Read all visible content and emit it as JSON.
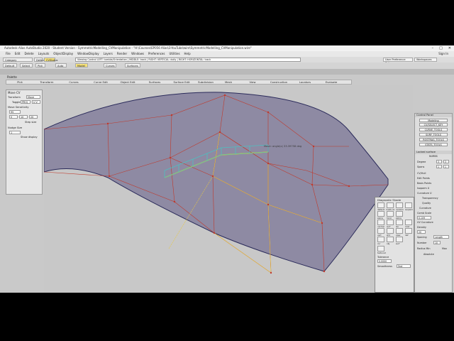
{
  "window": {
    "title": "Autodesk Alias AutoStudio 2020  -  Student Version  -  SymmetricModelling_CVManipulation - \"H:\\Courses\\EP056 Alias\\3-YouTube\\wire\\SymmetricModelling_CVManipulation.wire\"",
    "min": "–",
    "max": "□",
    "close": "✕"
  },
  "menu": {
    "items": [
      "File",
      "Edit",
      "Delete",
      "Layouts",
      "ObjectDisplay",
      "WindowDisplay",
      "Layers",
      "Render",
      "Windows",
      "Preferences",
      "Utilities",
      "Help"
    ],
    "signin": "Sign In"
  },
  "toolbar": {
    "category_label": "Category",
    "status_text": "Viewing Control    LEFT: tumble/Orientation  |  MIDDLE: track  |  RIGHT: VERTICAL: dolly  |  RIGHT: HORIZONTAL: track",
    "user_prefs": "User Preference Sets",
    "workspaces": "Workspaces",
    "default_label": "Default",
    "cv_status": "CVStatus",
    "row2_items": [
      "Default",
      "Select",
      "Pick",
      "Auto",
      "Model",
      "Curves",
      "Surfaces"
    ]
  },
  "palette": {
    "label": "Palette",
    "shelf_tabs": [
      "Pick",
      "Transform",
      "Curves",
      "Curve Edit",
      "Object Edit",
      "Surfaces",
      "Surface Edit",
      "Subdivision",
      "Mesh",
      "View",
      "Construction",
      "Locators",
      "Evaluate"
    ]
  },
  "move_cv_panel": {
    "title": "Move CV",
    "transform_label": "Transform",
    "transform_value": "Move",
    "toggle_label": "Toggle",
    "toggle_value": "PROJ",
    "toggle_value2": "U V",
    "move_sensitivity": "Move Sensitivity",
    "sensitivity_value": "95",
    "fields": [
      "0",
      "10",
      "20"
    ],
    "step_size_label": "Step size",
    "step_size_value": "",
    "nudge_size": "Nudge Size",
    "nudge_value": "1",
    "show_display": "Show display"
  },
  "viewport": {
    "annotation": "Move: angle(x) 33.39758 deg",
    "viewcube_label": "RIGHT",
    "axis_labels": {
      "y": "Y",
      "z": "Z"
    }
  },
  "control_panel": {
    "title": "Control Panel",
    "modeling": "Modeling",
    "cv_select": "CV/SELECT_KEY",
    "buttons": [
      "CURVE_TOOLS",
      "SURF_TOOLS",
      "ROSTRAG_TOOLS",
      "STATS_TOOLS"
    ],
    "locked_surface": "Locked surface",
    "nurbs_label": "NURBS",
    "degree_label": "Degree",
    "degree_u": "3",
    "degree_v": "3",
    "spans_label": "Spans",
    "spans_u": "1",
    "spans_v": "1",
    "cvs_hull": "CV/Hull",
    "edit_points": "Edit Points",
    "basis_points": "Basis Points",
    "isoparm_u": "Isoparm U",
    "curvature_u": "Curvature U",
    "transparency": "Transparency",
    "quality": "Quality",
    "curvature": "Curvature",
    "comb_scale": "Comb Scale",
    "comb_value": "0.109",
    "uv_curvature": "UV Curvature",
    "density": "Density",
    "density_value": "20",
    "spacing": "Spacing",
    "spacing_value": "Length",
    "number": "Number",
    "number_value": "10",
    "radius_min": "Radius Min",
    "radius_max": "Max",
    "absolute": "Absolute"
  },
  "diagnostic_shade": {
    "title": "Diagnostic Shade",
    "icons": [
      "default",
      "mulit-col",
      "random",
      "isoparm",
      "zebra",
      "horiz",
      "zebra",
      "normal",
      "surf",
      "Iso",
      "mod",
      "vert",
      "shd",
      "view",
      "def",
      "cur",
      "obj",
      "surf",
      "textured"
    ],
    "tolerance_label": "Tolerance",
    "tolerance_value": "0.0000",
    "smoothness": "Smoothness",
    "smoothness_value": "Fast"
  },
  "bottom_icons": [
    "Mirror",
    "Level",
    "Grid",
    "Mesh"
  ],
  "colors": {
    "viewport_bg": "#c8c8c8",
    "surface_fill": "#8e8aa3",
    "hull_lines": "#c0392b",
    "isoparms": "#e8c840",
    "selection": "#f4d400"
  }
}
